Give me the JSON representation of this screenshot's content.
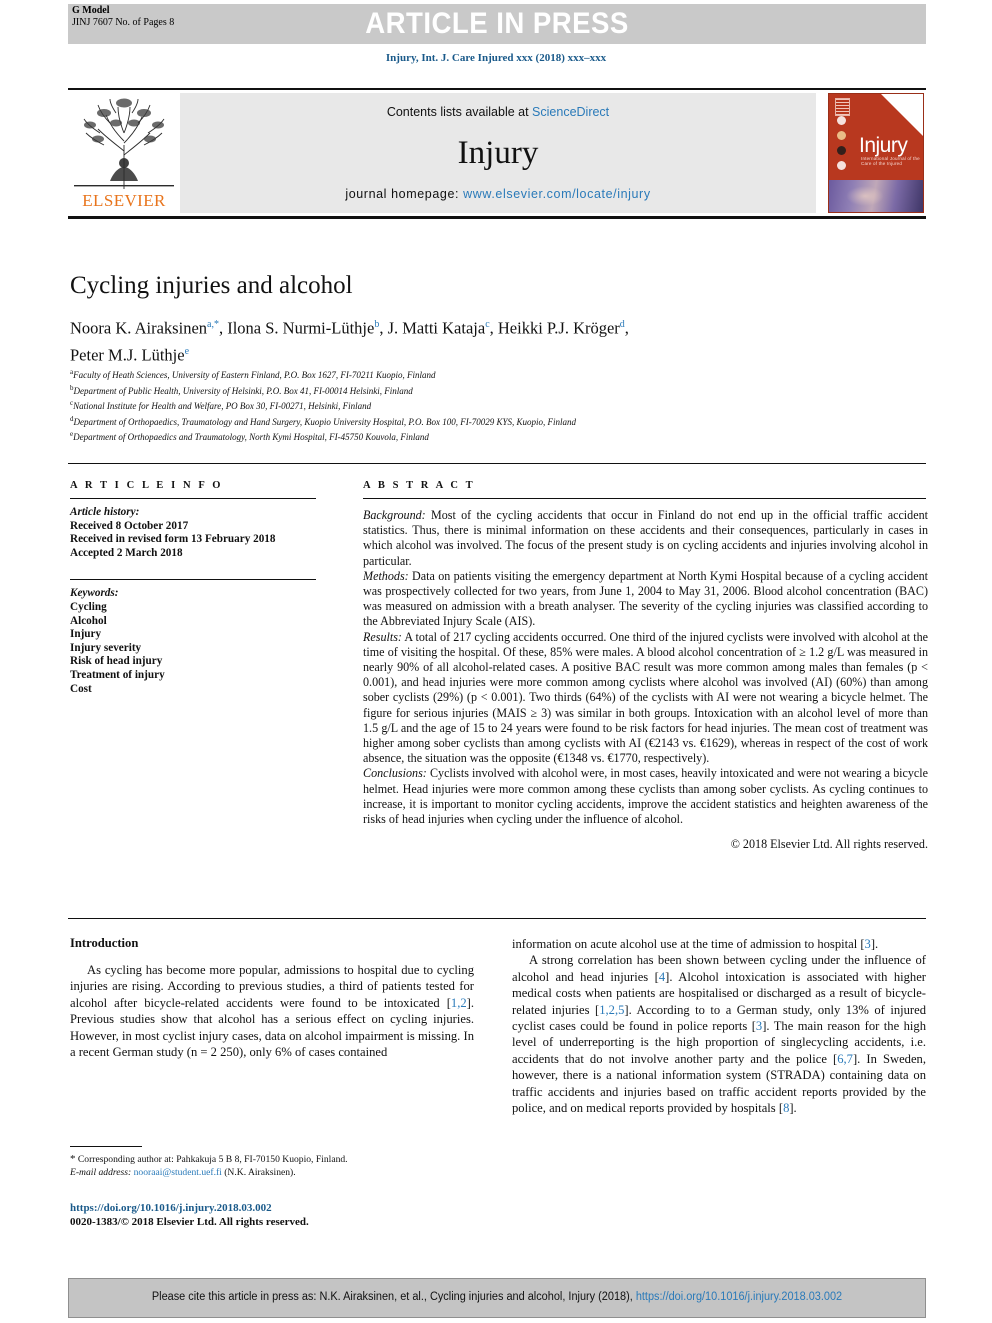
{
  "banner": {
    "gmodel_line1": "G Model",
    "gmodel_line2": "JINJ 7607 No. of Pages 8",
    "article_in_press": "ARTICLE IN PRESS"
  },
  "journal_ref": "Injury, Int. J. Care Injured xxx (2018) xxx–xxx",
  "masthead": {
    "contents_prefix": "Contents lists available at ",
    "sciencedirect": "ScienceDirect",
    "journal_name": "Injury",
    "homepage_prefix": "journal homepage: ",
    "homepage_url": "www.elsevier.com/locate/injury",
    "publisher": "ELSEVIER",
    "cover_title": "Injury",
    "cover_subtitle": "International Journal of the Care of the Injured"
  },
  "article": {
    "title": "Cycling injuries and alcohol",
    "authors": [
      {
        "name": "Noora K. Airaksinen",
        "marks": "a,*"
      },
      {
        "name": "Ilona S. Nurmi-Lüthje",
        "marks": "b"
      },
      {
        "name": "J. Matti Kataja",
        "marks": "c"
      },
      {
        "name": "Heikki P.J. Kröger",
        "marks": "d"
      },
      {
        "name": "Peter M.J. Lüthje",
        "marks": "e"
      }
    ],
    "affiliations": [
      {
        "mark": "a",
        "text": "Faculty of Heath Sciences, University of Eastern Finland, P.O. Box 1627, FI-70211 Kuopio, Finland"
      },
      {
        "mark": "b",
        "text": "Department of Public Health, University of Helsinki, P.O. Box 41, FI-00014 Helsinki, Finland"
      },
      {
        "mark": "c",
        "text": "National Institute for Health and Welfare, PO Box 30, FI-00271, Helsinki, Finland"
      },
      {
        "mark": "d",
        "text": "Department of Orthopaedics, Traumatology and Hand Surgery, Kuopio University Hospital, P.O. Box 100, FI-70029 KYS, Kuopio, Finland"
      },
      {
        "mark": "e",
        "text": "Department of Orthopaedics and Traumatology, North Kymi Hospital, FI-45750 Kouvola, Finland"
      }
    ]
  },
  "article_info": {
    "heading": "A R T I C L E  I N F O",
    "history_label": "Article history:",
    "history": [
      "Received 8 October 2017",
      "Received in revised form 13 February 2018",
      "Accepted 2 March 2018"
    ],
    "keywords_label": "Keywords:",
    "keywords": [
      "Cycling",
      "Alcohol",
      "Injury",
      "Injury severity",
      "Risk of head injury",
      "Treatment of injury",
      "Cost"
    ]
  },
  "abstract": {
    "heading": "A B S T R A C T",
    "background_label": "Background:",
    "background": " Most of the cycling accidents that occur in Finland do not end up in the official traffic accident statistics. Thus, there is minimal information on these accidents and their consequences, particularly in cases in which alcohol was involved. The focus of the present study is on cycling accidents and injuries involving alcohol in particular.",
    "methods_label": "Methods:",
    "methods": " Data on patients visiting the emergency department at North Kymi Hospital because of a cycling accident was prospectively collected for two years, from June 1, 2004 to May 31, 2006. Blood alcohol concentration (BAC) was measured on admission with a breath analyser. The severity of the cycling injuries was classified according to the Abbreviated Injury Scale (AIS).",
    "results_label": "Results:",
    "results": " A total of 217 cycling accidents occurred. One third of the injured cyclists were involved with alcohol at the time of visiting the hospital. Of these, 85% were males. A blood alcohol concentration of ≥ 1.2 g/L was measured in nearly 90% of all alcohol-related cases. A positive BAC result was more common among males than females (p < 0.001), and head injuries were more common among cyclists where alcohol was involved (AI) (60%) than among sober cyclists (29%) (p < 0.001). Two thirds (64%) of the cyclists with AI were not wearing a bicycle helmet. The figure for serious injuries (MAIS ≥ 3) was similar in both groups. Intoxication with an alcohol level of more than 1.5 g/L and the age of 15 to 24 years were found to be risk factors for head injuries. The mean cost of treatment was higher among sober cyclists than among cyclists with AI (€2143 vs. €1629), whereas in respect of the cost of work absence, the situation was the opposite (€1348 vs. €1770, respectively).",
    "conclusions_label": "Conclusions:",
    "conclusions": " Cyclists involved with alcohol were, in most cases, heavily intoxicated and were not wearing a bicycle helmet. Head injuries were more common among these cyclists than among sober cyclists. As cycling continues to increase, it is important to monitor cycling accidents, improve the accident statistics and heighten awareness of the risks of head injuries when cycling under the influence of alcohol.",
    "copyright": "© 2018 Elsevier Ltd. All rights reserved."
  },
  "introduction": {
    "heading": "Introduction",
    "left_p1_a": "As cycling has become more popular, admissions to hospital due to cycling injuries are rising. According to previous studies, a third of patients tested for alcohol after bicycle-related accidents were found to be intoxicated [",
    "left_p1_ref1": "1,2",
    "left_p1_b": "]. Previous studies show that alcohol has a serious effect on cycling injuries. However, in most cyclist injury cases, data on alcohol impairment is missing. In a recent German study (n = 2 250), only 6% of cases contained",
    "right_p1_a": "information on acute alcohol use at the time of admission to hospital [",
    "right_p1_ref": "3",
    "right_p1_b": "].",
    "right_p2_a": "A strong correlation has been shown between cycling under the influence of alcohol and head injuries [",
    "right_p2_ref1": "4",
    "right_p2_b": "]. Alcohol intoxication is associated with higher medical costs when patients are hospitalised or discharged as a result of bicycle-related injuries [",
    "right_p2_ref2": "1,2,5",
    "right_p2_c": "]. According to to a German study, only 13% of injured cyclist cases could be found in police reports [",
    "right_p2_ref3": "3",
    "right_p2_d": "]. The main reason for the high level of underreporting is the high proportion of singlecycling accidents, i.e. accidents that do not involve another party and the police [",
    "right_p2_ref4": "6,7",
    "right_p2_e": "]. In Sweden, however, there is a national information system (STRADA) containing data on traffic accidents and injuries based on traffic accident reports provided by the police, and on medical reports provided by hospitals [",
    "right_p2_ref5": "8",
    "right_p2_f": "]."
  },
  "footnote": {
    "star": "*",
    "corresponding": " Corresponding author at: Pahkakuja 5 B 8, FI-70150 Kuopio, Finland.",
    "email_label": "E-mail address:",
    "email": "nooraai@student.uef.fi",
    "email_owner": " (N.K. Airaksinen)."
  },
  "doi_block": {
    "doi": "https://doi.org/10.1016/j.injury.2018.03.002",
    "issn": "0020-1383/© 2018 Elsevier Ltd. All rights reserved."
  },
  "cite_box": {
    "prefix": "Please cite this article in press as: N.K. Airaksinen, et al., Cycling injuries and alcohol, Injury (2018), ",
    "link": "https://doi.org/10.1016/j.injury.2018.03.002"
  },
  "colors": {
    "link_blue": "#2a7ab9",
    "header_gray": "#c9c9c9",
    "masthead_gray": "#e8e8e8",
    "elsevier_orange": "#e8741c",
    "cover_red": "#b8381f"
  }
}
